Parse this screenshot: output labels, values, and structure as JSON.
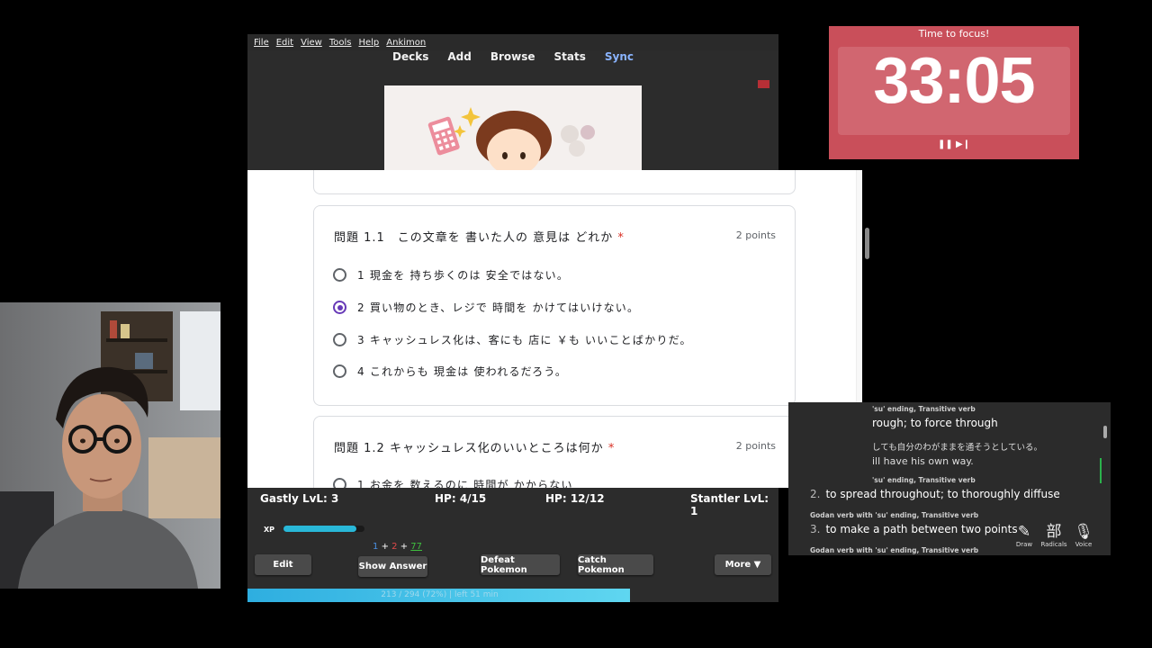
{
  "anki": {
    "menu": [
      "File",
      "Edit",
      "View",
      "Tools",
      "Help",
      "Ankimon"
    ],
    "toolbar": [
      "Decks",
      "Add",
      "Browse",
      "Stats",
      "Sync"
    ]
  },
  "form": {
    "questions": [
      {
        "title": "問題 1.1　この文章を 書いた人の 意見は どれか",
        "required_mark": "*",
        "points": "2 points",
        "options": [
          {
            "label": "1 現金を 持ち歩くのは 安全ではない。",
            "selected": false
          },
          {
            "label": "2 買い物のとき、レジで 時間を かけてはいけない。",
            "selected": true
          },
          {
            "label": "3 キャッシュレス化は、客にも 店に ￥も いいことばかりだ。",
            "selected": false
          },
          {
            "label": "4 これからも 現金は 使われるだろう。",
            "selected": false
          }
        ]
      },
      {
        "title": "問題 1.2 キャッシュレス化のいいところは何か",
        "required_mark": "*",
        "points": "2 points",
        "options": [
          {
            "label": "1 お金を 数えるのに 時間が かからない",
            "selected": false
          }
        ]
      }
    ],
    "fab_icon": "chevron-up-icon"
  },
  "game": {
    "left_pokemon": "Gastly LvL: 3",
    "left_hp": "HP: 4/15",
    "right_hp": "HP: 12/12",
    "right_pokemon": "Stantler LvL: 1",
    "xp_label": "XP",
    "xp_fraction": 0.9,
    "counts": {
      "new": "1",
      "plus1": "+",
      "learn": "2",
      "plus2": "+",
      "review": "77"
    },
    "buttons": {
      "edit": "Edit",
      "show_answer": "Show Answer",
      "defeat": "Defeat Pokemon",
      "catch": "Catch Pokemon",
      "more": "More ▼"
    },
    "progress_text": "213 / 294 (72%) | left 51 min",
    "progress_fraction": 0.72
  },
  "timer": {
    "title": "Time to focus!",
    "time": "33:05",
    "controls": "❚❚ ▶❙"
  },
  "dictionary": {
    "pos1": "'su' ending, Transitive verb",
    "gloss1": "rough; to force through",
    "sentence1": "しても自分のわがままを通そうとしている。",
    "translation1": "ill have his own way.",
    "pos2": "'su' ending, Transitive verb",
    "num2": "2.",
    "gloss2": "to spread throughout; to thoroughly diffuse",
    "pos3": "Godan verb with 'su' ending, Transitive verb",
    "num3": "3.",
    "gloss3": "to make a path between two points",
    "pos4": "Godan verb with 'su' ending, Transitive verb",
    "tools": [
      {
        "icon": "✎",
        "label": "Draw"
      },
      {
        "icon": "部",
        "label": "Radicals"
      },
      {
        "icon": "🎙",
        "label": "Voice"
      }
    ]
  },
  "colors": {
    "accent_purple": "#673ab7",
    "required_red": "#d93025",
    "timer_bg": "#c94f5a",
    "xp_cyan": "#29b8d8"
  }
}
